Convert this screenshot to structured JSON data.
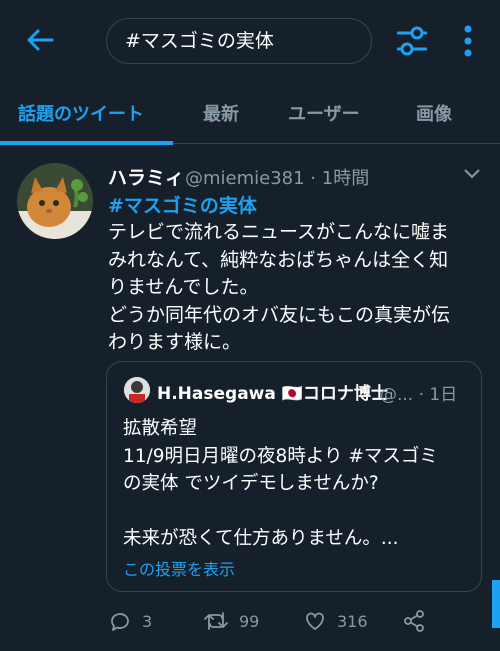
{
  "colors": {
    "background": "#15202b",
    "accent": "#1da1f2",
    "muted": "#8899a6",
    "border": "#38444d"
  },
  "header": {
    "back_icon": "arrow-left-icon",
    "search_value": "#マスゴミの実体",
    "filter_icon": "sliders-icon",
    "more_icon": "vertical-dots-icon"
  },
  "tabs": [
    {
      "label": "話題のツイート",
      "active": true
    },
    {
      "label": "最新",
      "active": false
    },
    {
      "label": "ユーザー",
      "active": false
    },
    {
      "label": "画像",
      "active": false
    }
  ],
  "tweet": {
    "display_name": "ハラミィ",
    "handle_time": "@miemie381 · 1時間",
    "hashtag": "#マスゴミの実体",
    "body_lines": [
      "テレビで流れるニュースがこんなに嘘ま",
      "みれなんて、純粋なおばちゃんは全く知",
      "りませんでした。",
      "どうか同年代のオバ友にもこの真実が伝",
      "わります様に。"
    ],
    "quoted": {
      "display_name": "H.Hasegawa 🇯🇵コロナ博士",
      "handle_time": "@... · 1日",
      "body_lines": [
        "拡散希望",
        "11/9明日月曜の夜8時より #マスゴミ",
        "の実体 でツイデモしませんか?",
        "",
        "未来が恐くて仕方ありません。..."
      ],
      "poll_link": "この投票を表示"
    },
    "actions": {
      "reply_count": "3",
      "retweet_count": "99",
      "like_count": "316"
    }
  }
}
